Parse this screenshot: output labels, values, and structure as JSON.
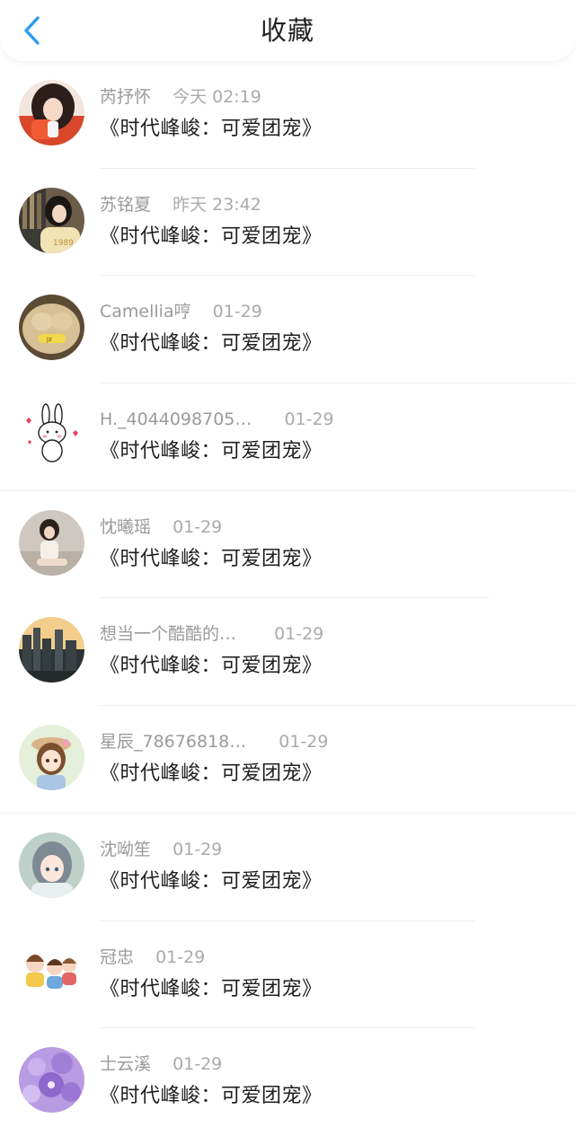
{
  "header": {
    "title": "收藏",
    "back_icon": "chevron-left-icon",
    "accent_color": "#2a9df4"
  },
  "favorites": [
    {
      "user": "芮抒怀",
      "time": "今天 02:19",
      "item": "《时代峰峻：可爱团宠》",
      "avatar": "avatar-red-girl"
    },
    {
      "user": "苏铭夏",
      "time": "昨天 23:42",
      "item": "《时代峰峻：可爱团宠》",
      "avatar": "avatar-girl-yellow-shirt"
    },
    {
      "user": "Camellia哼",
      "time": "01-29",
      "item": "《时代峰峻：可爱团宠》",
      "avatar": "avatar-fluffy-dog"
    },
    {
      "user": "H._4044098705…",
      "time": "01-29",
      "item": "《时代峰峻：可爱团宠》",
      "avatar": "avatar-bunny-sticker"
    },
    {
      "user": "忱曦瑶",
      "time": "01-29",
      "item": "《时代峰峻：可爱团宠》",
      "avatar": "avatar-girl-photo"
    },
    {
      "user": "想当一个酷酷的…",
      "time": "01-29",
      "item": "《时代峰峻：可爱团宠》",
      "avatar": "avatar-city-skyline"
    },
    {
      "user": "星辰_78676818…",
      "time": "01-29",
      "item": "《时代峰峻：可爱团宠》",
      "avatar": "avatar-anime-girl-hat"
    },
    {
      "user": "沈呦笙",
      "time": "01-29",
      "item": "《时代峰峻：可爱团宠》",
      "avatar": "avatar-anime-girl-blue"
    },
    {
      "user": "冠忠",
      "time": "01-29",
      "item": "《时代峰峻：可爱团宠》",
      "avatar": "avatar-cartoon-kids"
    },
    {
      "user": "士云溪",
      "time": "01-29",
      "item": "《时代峰峻：可爱团宠》",
      "avatar": "avatar-purple-flowers"
    }
  ]
}
